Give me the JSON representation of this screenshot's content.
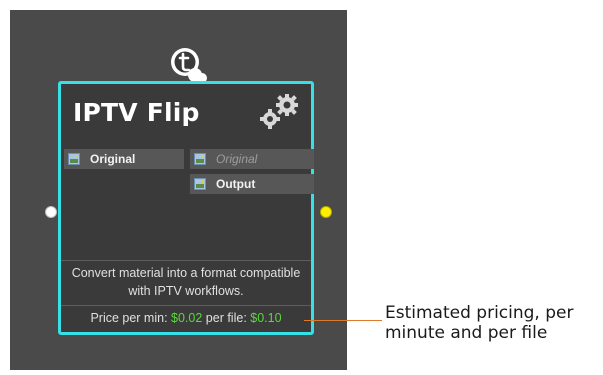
{
  "node": {
    "title": "IPTV Flip",
    "inputs": [
      {
        "label": "Original"
      }
    ],
    "outputs": [
      {
        "label": "Original"
      },
      {
        "label": "Output"
      }
    ],
    "description": "Convert material into a format compatible with IPTV workflows.",
    "pricing": {
      "per_min_label": "Price per min:",
      "per_min_value": "$0.02",
      "per_file_label": "per file:",
      "per_file_value": "$0.10"
    }
  },
  "annotation": {
    "text": "Estimated pricing, per minute and per file"
  },
  "icons": {
    "logo": "telestream-logo-icon",
    "settings": "gears-icon",
    "port": "media-file-icon"
  },
  "colors": {
    "node_border": "#35e0e6",
    "price_value": "#5ad83e",
    "output_connector": "#ffee00",
    "input_connector": "#ffffff",
    "callout_line": "#e07a2b"
  }
}
